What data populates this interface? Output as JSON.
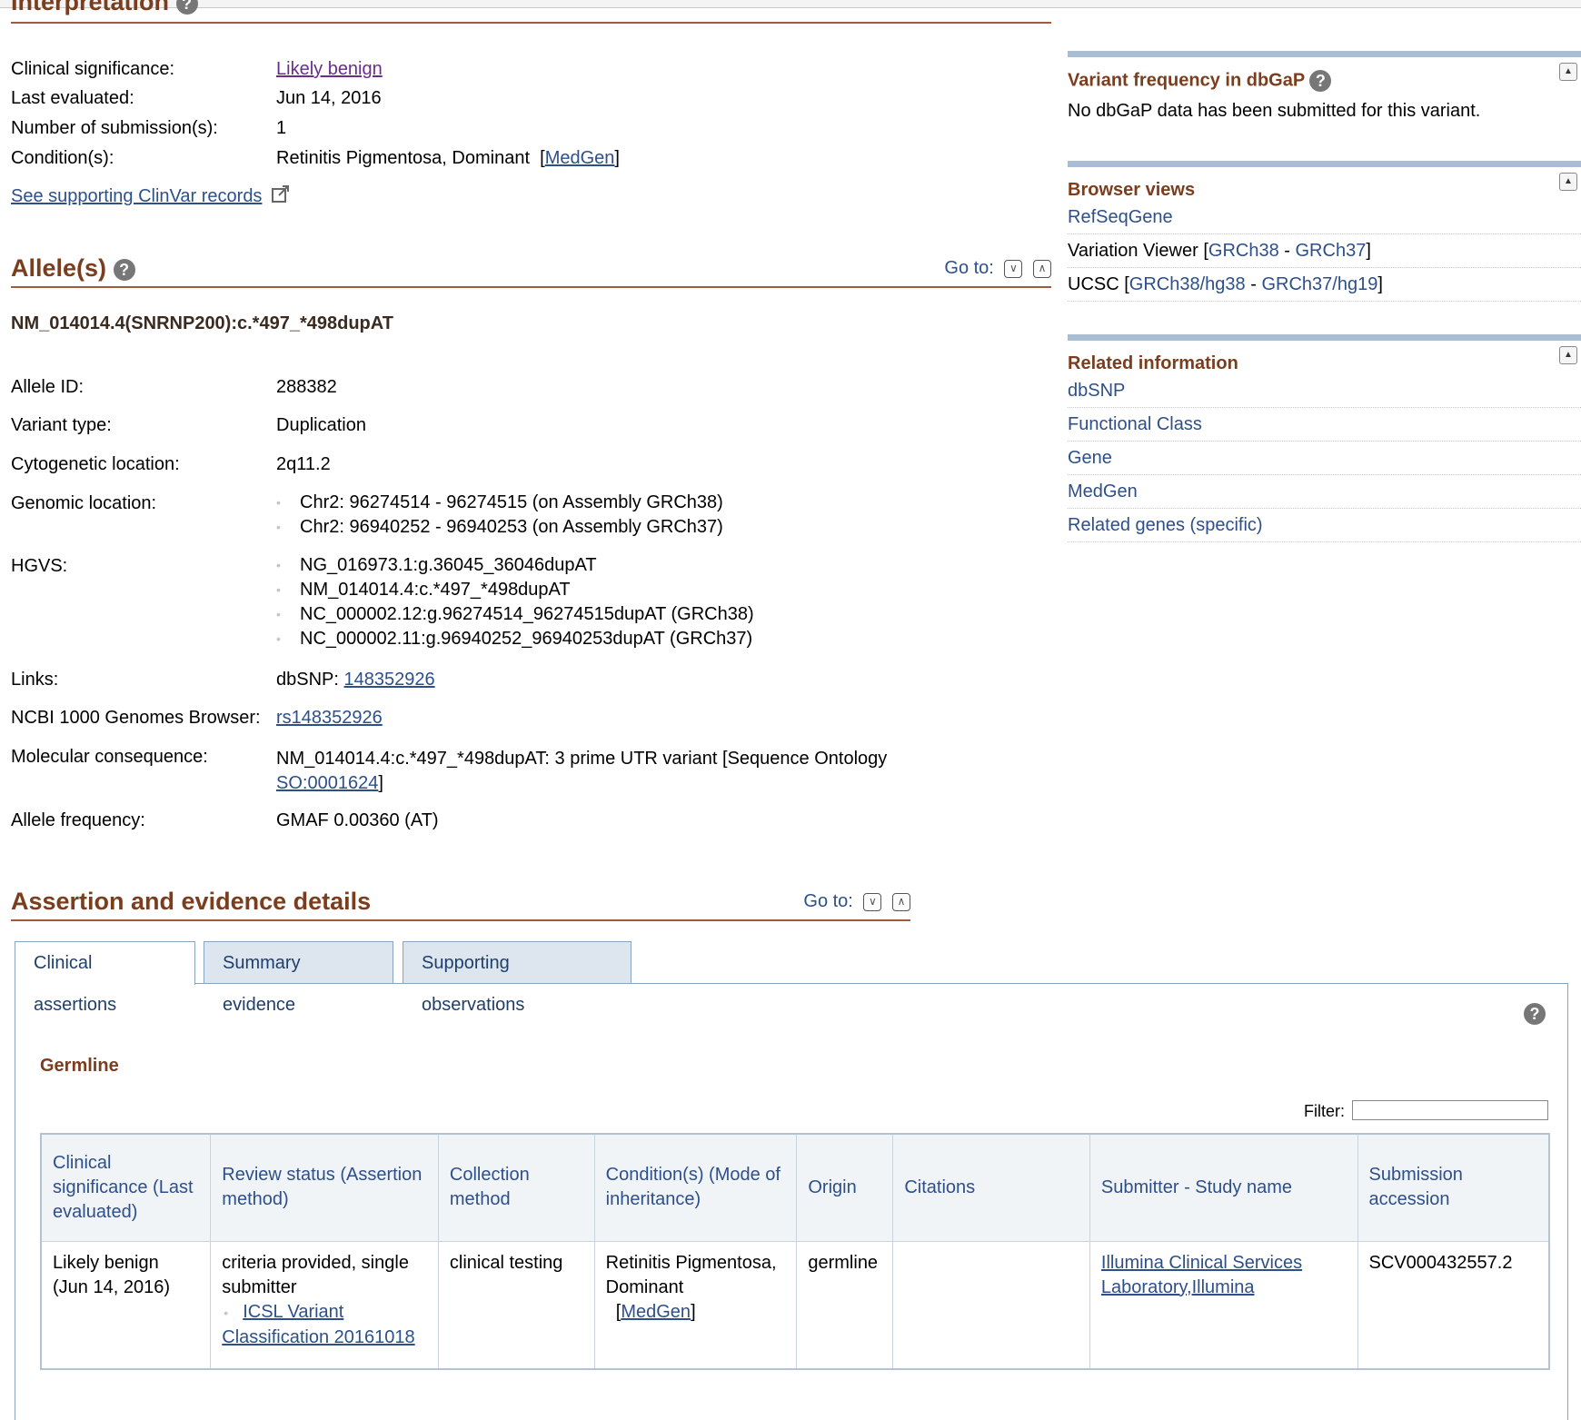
{
  "interpretation": {
    "title": "Interpretation",
    "clinical_significance_label": "Clinical significance:",
    "clinical_significance_value": "Likely benign",
    "last_evaluated_label": "Last evaluated:",
    "last_evaluated_value": "Jun 14, 2016",
    "num_submissions_label": "Number of submission(s):",
    "num_submissions_value": "1",
    "conditions_label": "Condition(s):",
    "conditions_value": "Retinitis Pigmentosa, Dominant",
    "conditions_link": "MedGen",
    "see_supporting": "See supporting ClinVar records"
  },
  "alleles": {
    "title": "Allele(s)",
    "goto": "Go to:",
    "variant_name": "NM_014014.4(SNRNP200):c.*497_*498dupAT",
    "allele_id_label": "Allele ID:",
    "allele_id_value": "288382",
    "variant_type_label": "Variant type:",
    "variant_type_value": "Duplication",
    "cytogenetic_label": "Cytogenetic location:",
    "cytogenetic_value": "2q11.2",
    "genomic_label": "Genomic location:",
    "genomic_values": [
      "Chr2: 96274514 - 96274515 (on Assembly GRCh38)",
      "Chr2: 96940252 - 96940253 (on Assembly GRCh37)"
    ],
    "hgvs_label": "HGVS:",
    "hgvs_values": [
      "NG_016973.1:g.36045_36046dupAT",
      "NM_014014.4:c.*497_*498dupAT",
      "NC_000002.12:g.96274514_96274515dupAT (GRCh38)",
      "NC_000002.11:g.96940252_96940253dupAT (GRCh37)"
    ],
    "links_label": "Links:",
    "links_prefix": "dbSNP:",
    "links_value": "148352926",
    "ncbi_label": "NCBI 1000 Genomes Browser:",
    "ncbi_value": "rs148352926",
    "molecular_label": "Molecular consequence:",
    "molecular_value": "NM_014014.4:c.*497_*498dupAT: 3 prime UTR variant [Sequence Ontology",
    "molecular_link": "SO:0001624",
    "allele_freq_label": "Allele frequency:",
    "allele_freq_value": "GMAF 0.00360 (AT)"
  },
  "assertion": {
    "title": "Assertion and evidence details",
    "goto": "Go to:",
    "tabs": [
      "Clinical assertions",
      "Summary evidence",
      "Supporting observations"
    ],
    "germline_title": "Germline",
    "filter_label": "Filter:",
    "columns": [
      "Clinical significance (Last evaluated)",
      "Review status (Assertion method)",
      "Collection method",
      "Condition(s) (Mode of inheritance)",
      "Origin",
      "Citations",
      "Submitter - Study name",
      "Submission accession"
    ],
    "row": {
      "significance": "Likely benign",
      "significance_date": "(Jun 14, 2016)",
      "review_status": "criteria provided, single submitter",
      "assertion_method": "ICSL Variant Classification 20161018",
      "collection": "clinical testing",
      "condition": "Retinitis Pigmentosa, Dominant",
      "condition_link": "MedGen",
      "origin": "germline",
      "citations": "",
      "submitter": "Illumina Clinical Services Laboratory,Illumina",
      "accession": "SCV000432557.2"
    }
  },
  "sidebar": {
    "dbgap_title": "Variant frequency in dbGaP",
    "dbgap_text": "No dbGaP data has been submitted for this variant.",
    "browser_title": "Browser views",
    "refseqgene": "RefSeqGene",
    "variation_viewer_label": "Variation Viewer [",
    "variation_viewer_link1": "GRCh38",
    "variation_viewer_link2": "GRCh37",
    "ucsc_label": "UCSC [",
    "ucsc_link1": "GRCh38/hg38",
    "ucsc_link2": "GRCh37/hg19",
    "separator": " - ",
    "close_bracket": "]",
    "related_title": "Related information",
    "related_items": [
      "dbSNP",
      "Functional Class",
      "Gene",
      "MedGen",
      "Related genes (specific)"
    ]
  }
}
